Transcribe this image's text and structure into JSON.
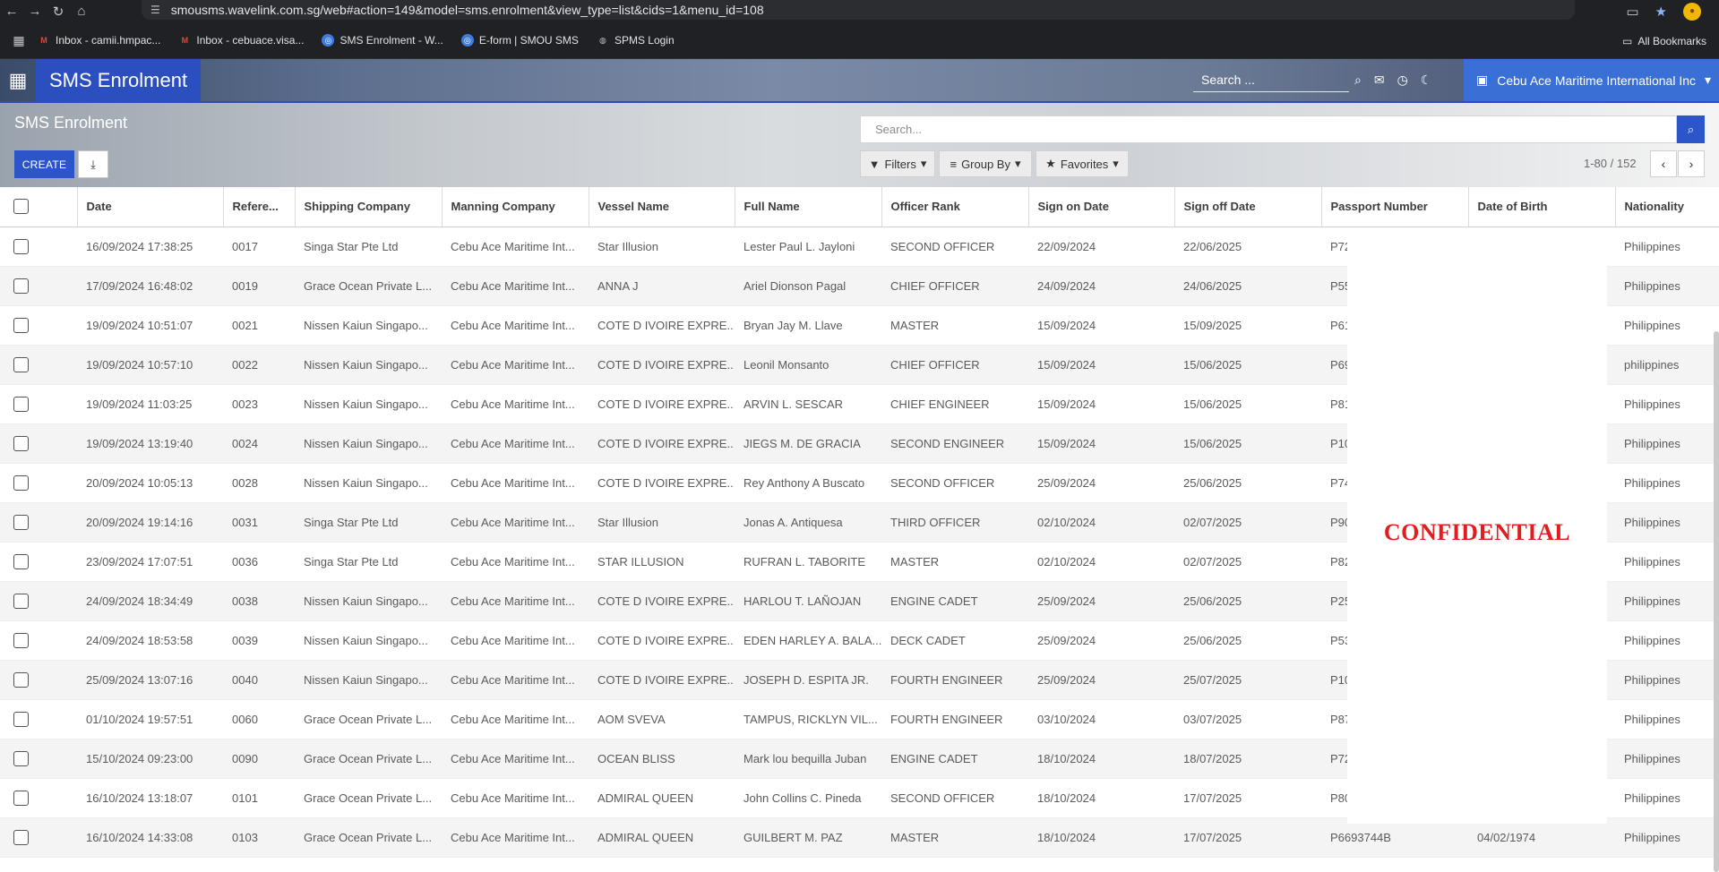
{
  "browser": {
    "url": "smousms.wavelink.com.sg/web#action=149&model=sms.enrolment&view_type=list&cids=1&menu_id=108",
    "bookmarks": [
      {
        "label": "Inbox - camii.hmpac...",
        "icon": "gmail-icon"
      },
      {
        "label": "Inbox - cebuace.visa...",
        "icon": "gmail-icon"
      },
      {
        "label": "SMS Enrolment - W...",
        "icon": "globe-icon"
      },
      {
        "label": "E-form | SMOU SMS",
        "icon": "globe-icon"
      },
      {
        "label": "SPMS Login",
        "icon": "world-icon"
      }
    ],
    "all_bookmarks": "All Bookmarks"
  },
  "header": {
    "app_title": "SMS Enrolment",
    "search_placeholder": "Search ...",
    "company": "Cebu Ace Maritime International Inc"
  },
  "control_panel": {
    "title": "SMS Enrolment",
    "create_label": "CREATE",
    "search_placeholder": "Search...",
    "filters_label": "Filters",
    "group_by_label": "Group By",
    "favorites_label": "Favorites",
    "pager": "1-80 / 152"
  },
  "table": {
    "columns": [
      "Date",
      "Refere...",
      "Shipping Company",
      "Manning Company",
      "Vessel Name",
      "Full Name",
      "Officer Rank",
      "Sign on Date",
      "Sign off Date",
      "Passport Number",
      "Date of Birth",
      "Nationality"
    ],
    "rows": [
      [
        "16/09/2024 17:38:25",
        "0017",
        "Singa Star Pte Ltd",
        "Cebu Ace Maritime Int...",
        "Star Illusion",
        "Lester Paul L. Jayloni",
        "SECOND OFFICER",
        "22/09/2024",
        "22/06/2025",
        "P72",
        "",
        "Philippines"
      ],
      [
        "17/09/2024 16:48:02",
        "0019",
        "Grace Ocean Private L...",
        "Cebu Ace Maritime Int...",
        "ANNA J",
        "Ariel Dionson Pagal",
        "CHIEF OFFICER",
        "24/09/2024",
        "24/06/2025",
        "P55",
        "",
        "Philippines"
      ],
      [
        "19/09/2024 10:51:07",
        "0021",
        "Nissen Kaiun Singapo...",
        "Cebu Ace Maritime Int...",
        "COTE D IVOIRE EXPRE...",
        "Bryan Jay M. Llave",
        "MASTER",
        "15/09/2024",
        "15/09/2025",
        "P61",
        "",
        "Philippines"
      ],
      [
        "19/09/2024 10:57:10",
        "0022",
        "Nissen Kaiun Singapo...",
        "Cebu Ace Maritime Int...",
        "COTE D IVOIRE EXPRE...",
        "Leonil Monsanto",
        "CHIEF OFFICER",
        "15/09/2024",
        "15/06/2025",
        "P69",
        "",
        "philippines"
      ],
      [
        "19/09/2024 11:03:25",
        "0023",
        "Nissen Kaiun Singapo...",
        "Cebu Ace Maritime Int...",
        "COTE D IVOIRE EXPRE...",
        "ARVIN L. SESCAR",
        "CHIEF ENGINEER",
        "15/09/2024",
        "15/06/2025",
        "P81",
        "",
        "Philippines"
      ],
      [
        "19/09/2024 13:19:40",
        "0024",
        "Nissen Kaiun Singapo...",
        "Cebu Ace Maritime Int...",
        "COTE D IVOIRE EXPRE...",
        "JIEGS M. DE GRACIA",
        "SECOND ENGINEER",
        "15/09/2024",
        "15/06/2025",
        "P10",
        "",
        "Philippines"
      ],
      [
        "20/09/2024 10:05:13",
        "0028",
        "Nissen Kaiun Singapo...",
        "Cebu Ace Maritime Int...",
        "COTE D IVOIRE EXPRE...",
        "Rey Anthony A Buscato",
        "SECOND OFFICER",
        "25/09/2024",
        "25/06/2025",
        "P74",
        "",
        "Philippines"
      ],
      [
        "20/09/2024 19:14:16",
        "0031",
        "Singa Star Pte Ltd",
        "Cebu Ace Maritime Int...",
        "Star Illusion",
        "Jonas A. Antiquesa",
        "THIRD OFFICER",
        "02/10/2024",
        "02/07/2025",
        "P90",
        "",
        "Philippines"
      ],
      [
        "23/09/2024 17:07:51",
        "0036",
        "Singa Star Pte Ltd",
        "Cebu Ace Maritime Int...",
        "STAR ILLUSION",
        "RUFRAN L. TABORITE",
        "MASTER",
        "02/10/2024",
        "02/07/2025",
        "P82",
        "",
        "Philippines"
      ],
      [
        "24/09/2024 18:34:49",
        "0038",
        "Nissen Kaiun Singapo...",
        "Cebu Ace Maritime Int...",
        "COTE D IVOIRE EXPRE...",
        "HARLOU T. LAÑOJAN",
        "ENGINE CADET",
        "25/09/2024",
        "25/06/2025",
        "P25",
        "",
        "Philippines"
      ],
      [
        "24/09/2024 18:53:58",
        "0039",
        "Nissen Kaiun Singapo...",
        "Cebu Ace Maritime Int...",
        "COTE D IVOIRE EXPRE...",
        "EDEN HARLEY A. BALA...",
        "DECK CADET",
        "25/09/2024",
        "25/06/2025",
        "P53",
        "",
        "Philippines"
      ],
      [
        "25/09/2024 13:07:16",
        "0040",
        "Nissen Kaiun Singapo...",
        "Cebu Ace Maritime Int...",
        "COTE D IVOIRE EXPRE...",
        "JOSEPH D. ESPITA JR.",
        "FOURTH ENGINEER",
        "25/09/2024",
        "25/07/2025",
        "P10",
        "",
        "Philippines"
      ],
      [
        "01/10/2024 19:57:51",
        "0060",
        "Grace Ocean Private L...",
        "Cebu Ace Maritime Int...",
        "AOM SVEVA",
        "TAMPUS, RICKLYN VIL...",
        "FOURTH ENGINEER",
        "03/10/2024",
        "03/07/2025",
        "P87",
        "",
        "Philippines"
      ],
      [
        "15/10/2024 09:23:00",
        "0090",
        "Grace Ocean Private L...",
        "Cebu Ace Maritime Int...",
        "OCEAN BLISS",
        "Mark lou bequilla Juban",
        "ENGINE CADET",
        "18/10/2024",
        "18/07/2025",
        "P72",
        "",
        "Philippines"
      ],
      [
        "16/10/2024 13:18:07",
        "0101",
        "Grace Ocean Private L...",
        "Cebu Ace Maritime Int...",
        "ADMIRAL QUEEN",
        "John Collins C. Pineda",
        "SECOND OFFICER",
        "18/10/2024",
        "17/07/2025",
        "P80",
        "",
        "Philippines"
      ],
      [
        "16/10/2024 14:33:08",
        "0103",
        "Grace Ocean Private L...",
        "Cebu Ace Maritime Int...",
        "ADMIRAL QUEEN",
        "GUILBERT M. PAZ",
        "MASTER",
        "18/10/2024",
        "17/07/2025",
        "P6693744B",
        "04/02/1974",
        "Philippines"
      ]
    ]
  },
  "overlay": {
    "text": "CONFIDENTIAL",
    "color": "#e11d1d"
  },
  "colors": {
    "primary": "#2c55c9",
    "company_bar": "#3a6fd6"
  }
}
